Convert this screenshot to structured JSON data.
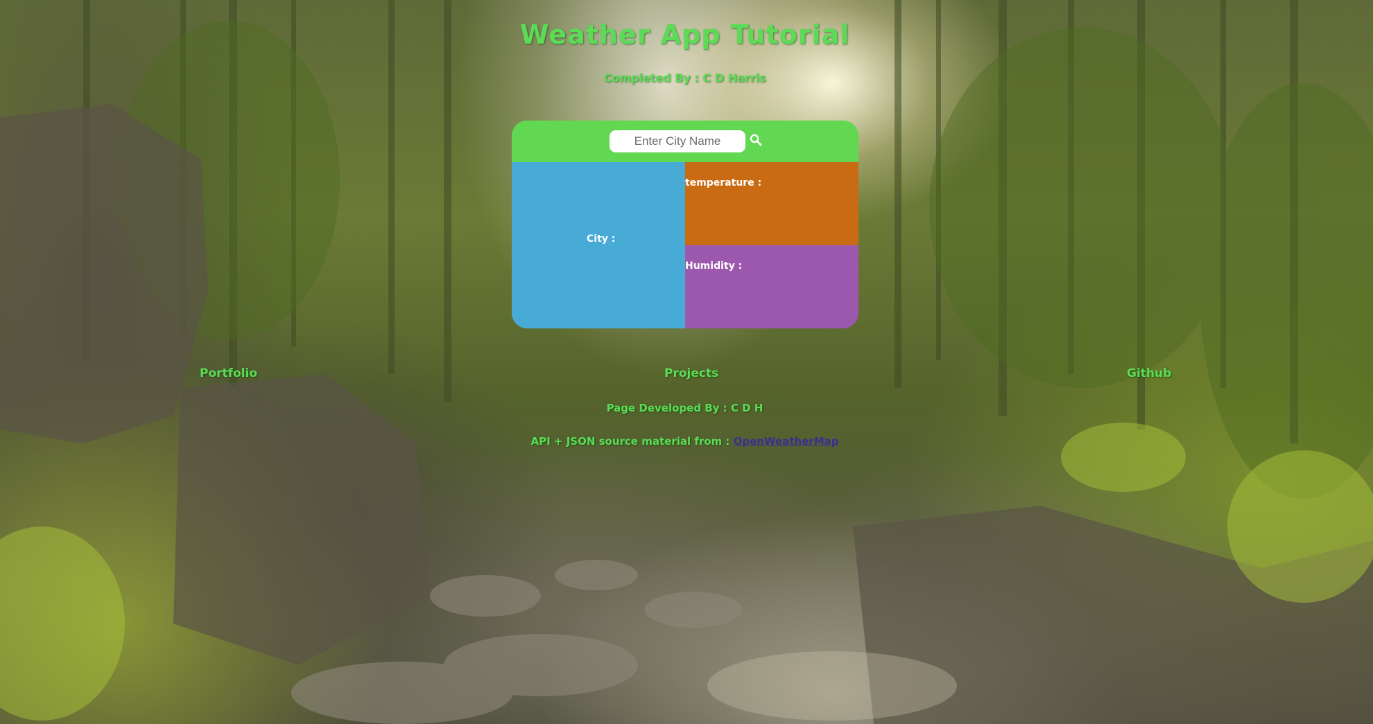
{
  "header": {
    "title": "Weather App Tutorial",
    "subtitle": "Completed By : C D Harris"
  },
  "search": {
    "placeholder": "Enter City Name",
    "value": ""
  },
  "weather": {
    "city_label": "City :",
    "temperature_label": "temperature :",
    "humidity_label": "Humidity :"
  },
  "nav": {
    "portfolio": "Portfolio",
    "projects": "Projects",
    "github": "Github"
  },
  "footer": {
    "developed_by": "Page Developed By : C D H",
    "source_text": "API + JSON source material from :",
    "source_link": "OpenWeatherMap"
  },
  "colors": {
    "accent_green": "#5ddb57",
    "search_bar": "#62d852",
    "city_panel": "#47abd6",
    "temperature_panel": "#c96b12",
    "humidity_panel": "#9b58ad",
    "link": "#3a2f8f"
  },
  "icons": {
    "search": "search-icon",
    "background": "forest-stream-image"
  }
}
